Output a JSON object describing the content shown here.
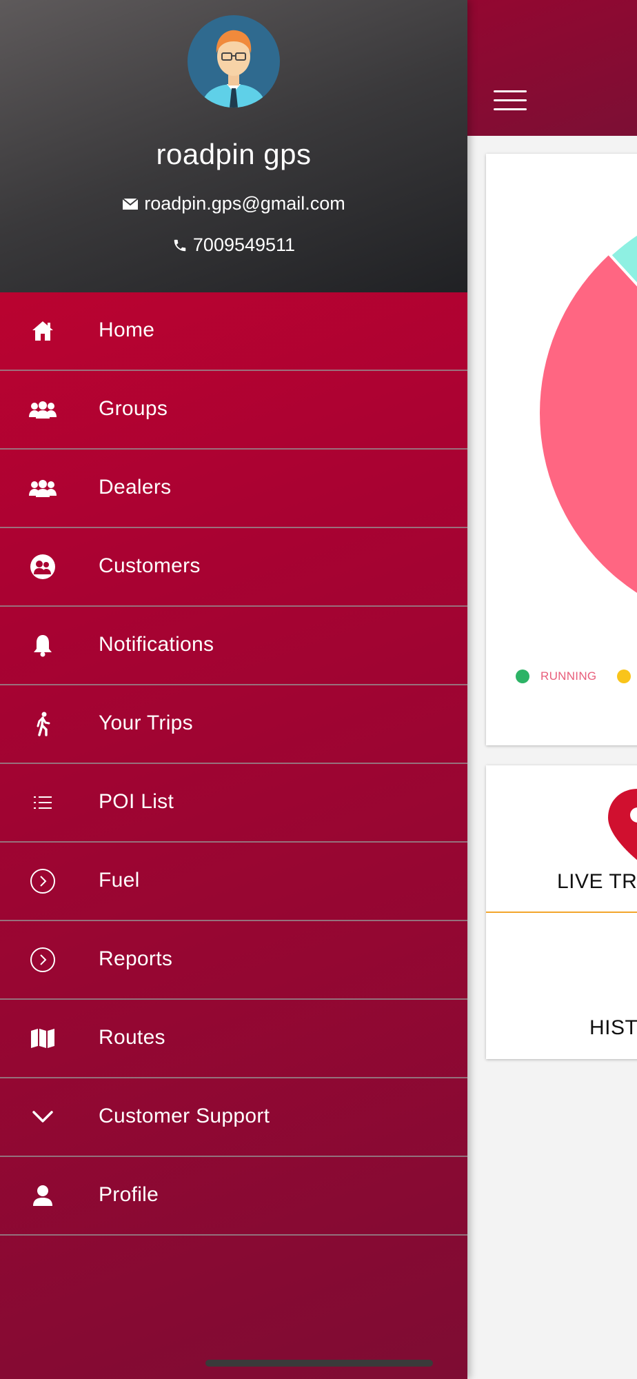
{
  "app": {
    "colors": {
      "header_gradient": [
        "#a8002e",
        "#7c0f34"
      ],
      "drawer_gradient": [
        "#c9042f",
        "#7e0c33"
      ],
      "accent_orange": "#f2a52b",
      "running": "#2db366",
      "idle": "#f9c41b",
      "pie_pink": "#ff6682",
      "pie_teal": "#8ef0e2"
    },
    "menu_button_icon": "hamburger-icon"
  },
  "drawer": {
    "user": {
      "name": "roadpin gps",
      "email": "roadpin.gps@gmail.com",
      "phone": "7009549511",
      "email_icon": "envelope-icon",
      "phone_icon": "phone-icon"
    },
    "items": [
      {
        "label": "Home",
        "icon": "home-icon"
      },
      {
        "label": "Groups",
        "icon": "group-icon"
      },
      {
        "label": "Dealers",
        "icon": "group-icon"
      },
      {
        "label": "Customers",
        "icon": "customers-icon"
      },
      {
        "label": "Notifications",
        "icon": "bell-icon"
      },
      {
        "label": "Your Trips",
        "icon": "walking-icon"
      },
      {
        "label": "POI List",
        "icon": "list-icon"
      },
      {
        "label": "Fuel",
        "icon": "chevron-circle-icon"
      },
      {
        "label": "Reports",
        "icon": "chevron-circle-icon"
      },
      {
        "label": "Routes",
        "icon": "map-icon"
      },
      {
        "label": "Customer Support",
        "icon": "chevron-down-icon"
      },
      {
        "label": "Profile",
        "icon": "person-icon"
      }
    ]
  },
  "dashboard": {
    "legend": [
      {
        "label": "RUNNING",
        "color": "#2db366"
      },
      {
        "label": "",
        "color": "#f9c41b"
      }
    ],
    "tiles": [
      {
        "label": "LIVE TRA",
        "icon": "map-pin-icon"
      },
      {
        "label": "HIST",
        "icon": "clock-icon"
      }
    ]
  }
}
